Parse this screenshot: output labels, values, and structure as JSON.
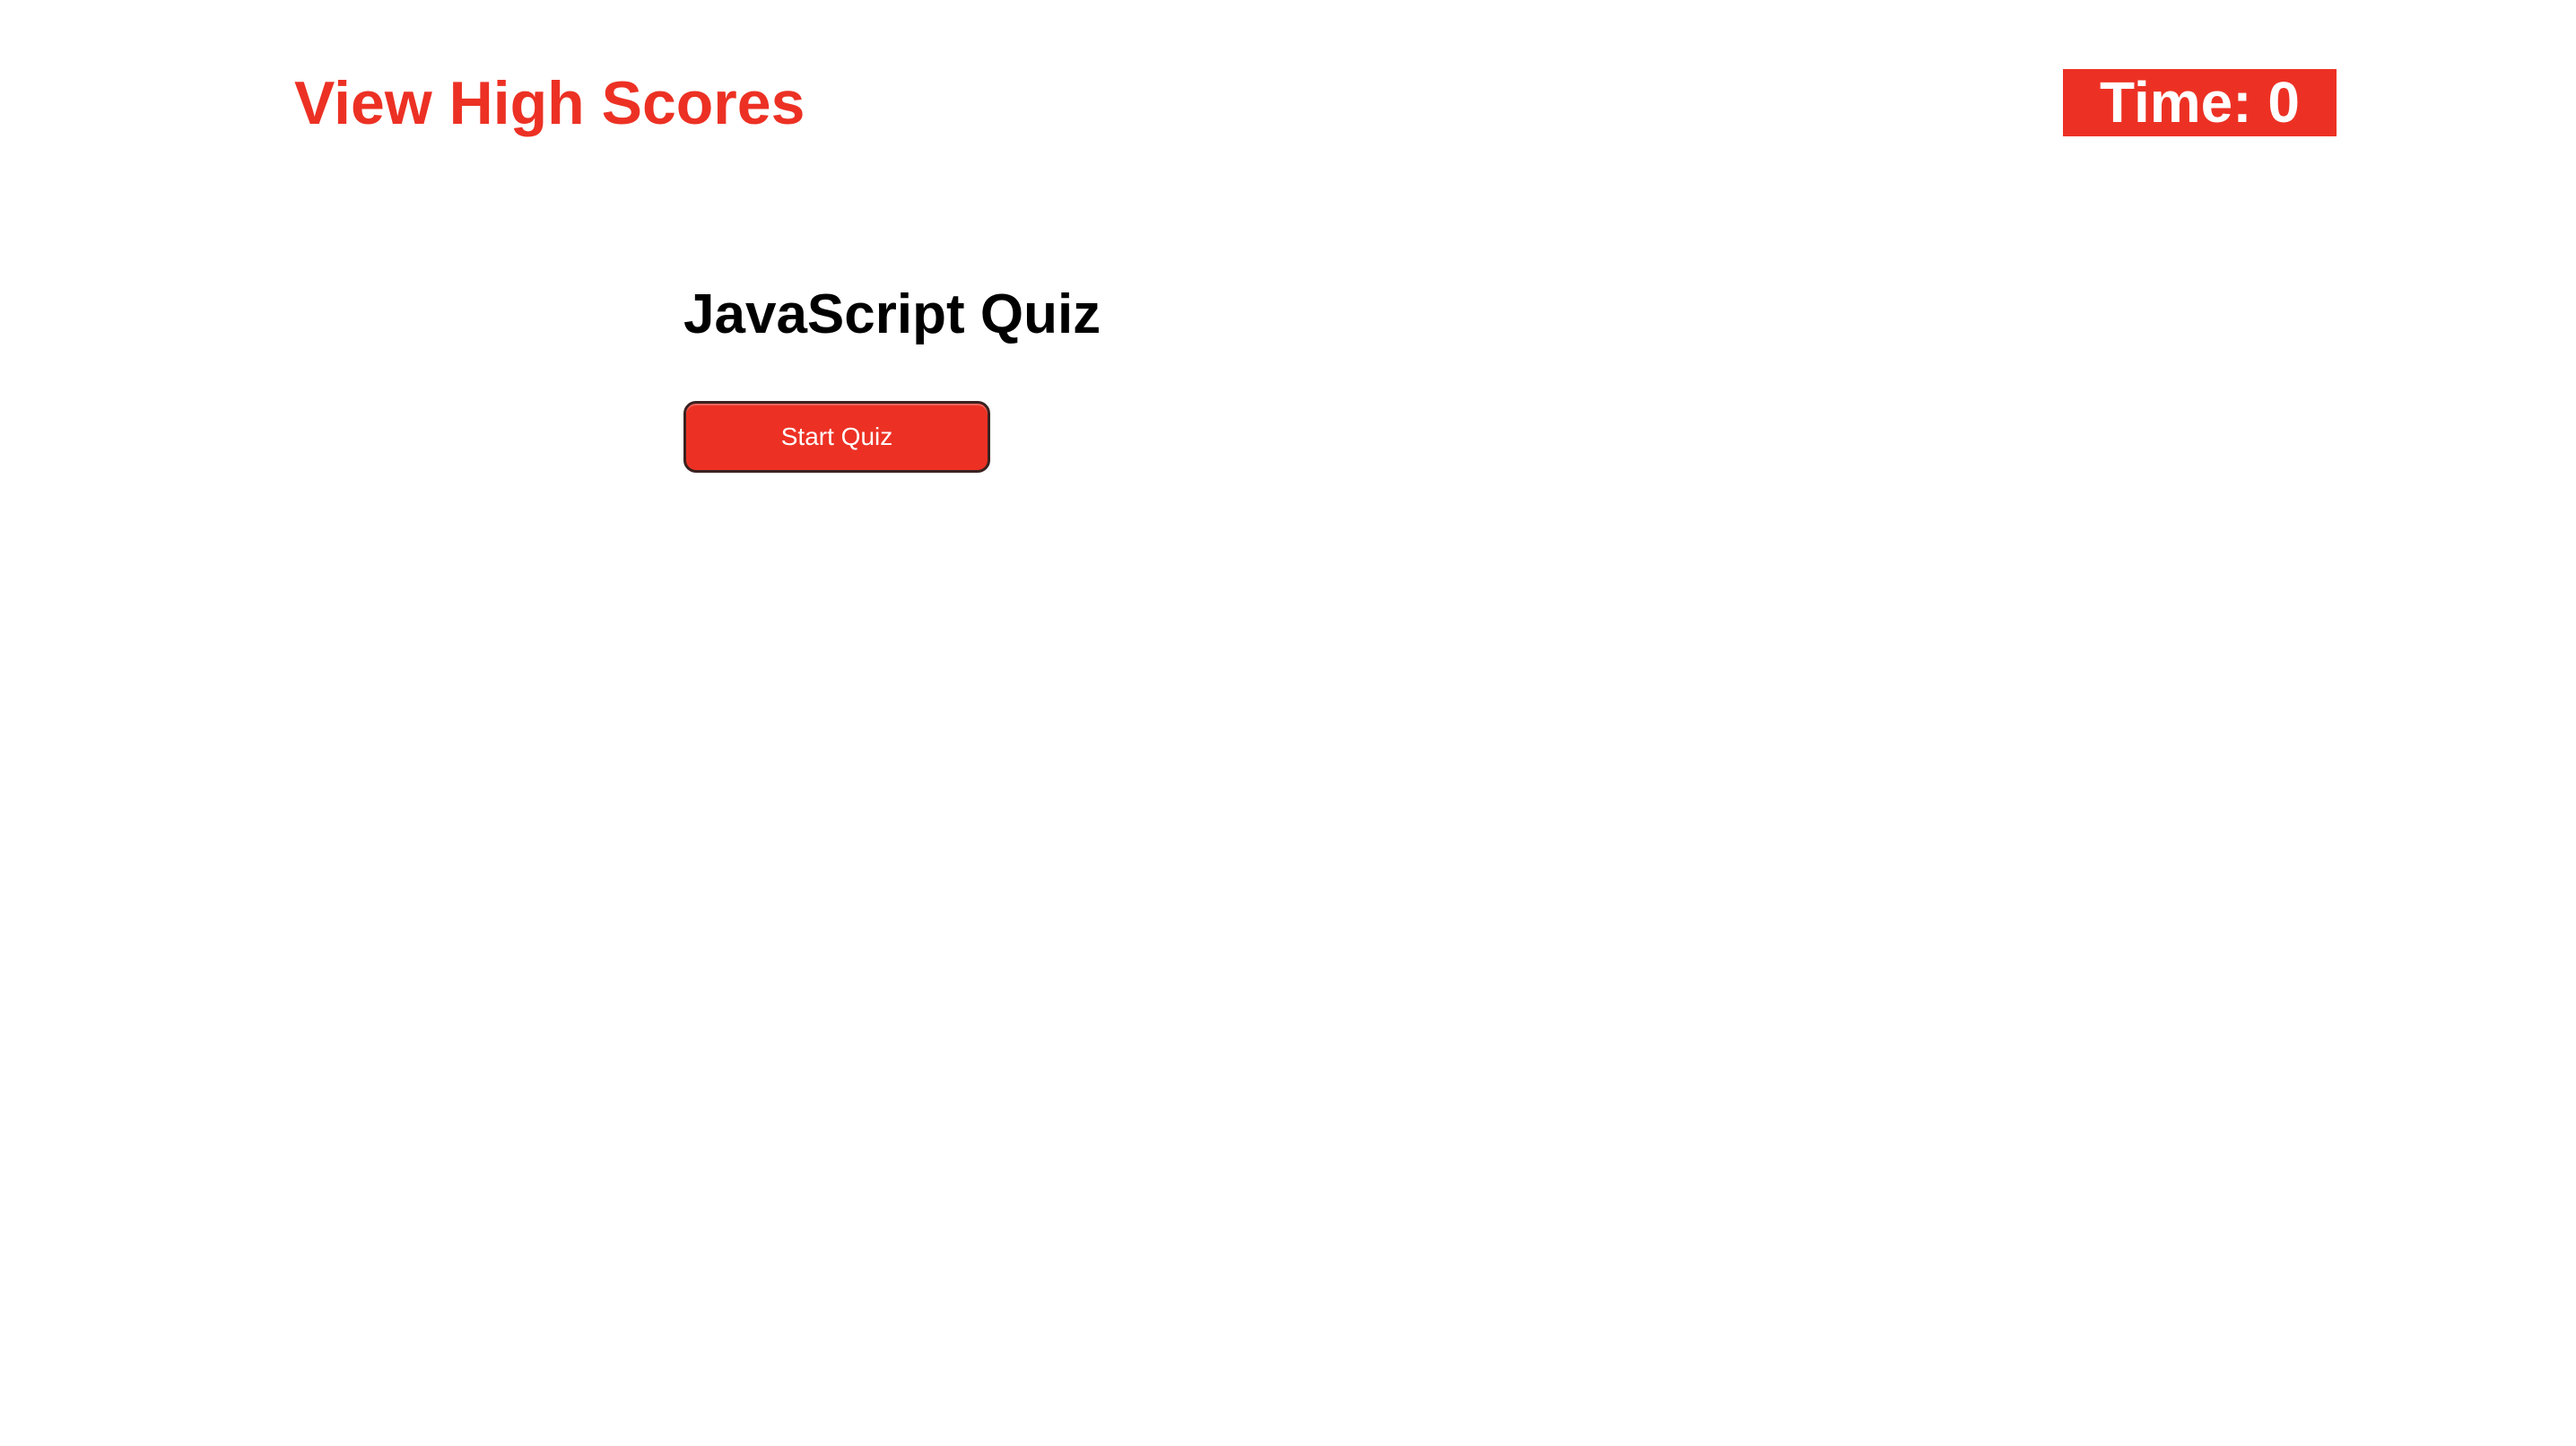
{
  "header": {
    "high_scores_label": "View High Scores",
    "timer_label": "Time:",
    "timer_value": "0"
  },
  "main": {
    "title": "JavaScript Quiz",
    "start_button_label": "Start Quiz"
  },
  "colors": {
    "accent": "#ec3124",
    "text_on_accent": "#ffffff",
    "title_text": "#000000",
    "background": "#ffffff"
  }
}
